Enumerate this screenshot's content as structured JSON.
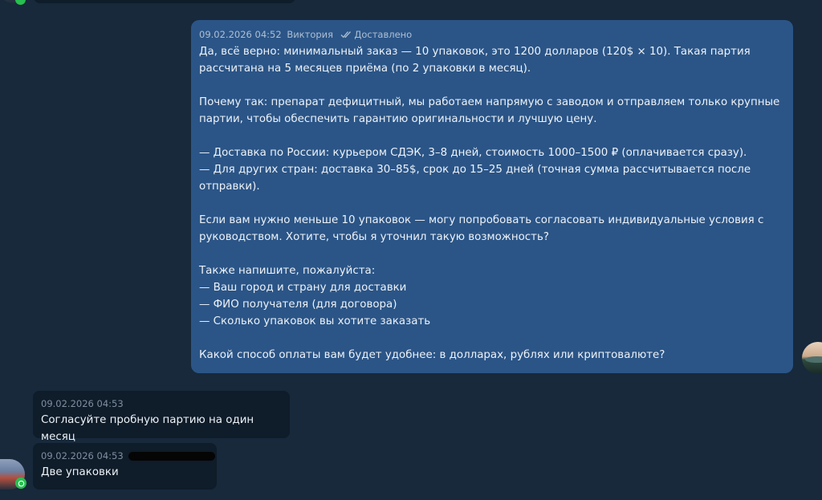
{
  "messages": [
    {
      "direction": "outgoing",
      "timestamp": "09.02.2026 04:52",
      "sender": "Виктория",
      "status": "Доставлено",
      "text": "Да, всё верно: минимальный заказ — 10 упаковок, это 1200 долларов (120$ × 10). Такая партия\nрассчитана на 5 месяцев приёма (по 2 упаковки в месяц).\n\nПочему так: препарат дефицитный, мы работаем напрямую с заводом и отправляем только крупные\nпартии, чтобы обеспечить гарантию оригинальности и лучшую цену.\n\n— Доставка по России: курьером СДЭК, 3–8 дней, стоимость 1000–1500 ₽ (оплачивается сразу).\n— Для других стран: доставка 30–85$, срок до 15–25 дней (точная сумма рассчитывается после\nотправки).\n\nЕсли вам нужно меньше 10 упаковок — могу попробовать согласовать индивидуальные условия с\nруководством. Хотите, чтобы я уточнил такую возможность?\n\nТакже напишите, пожалуйста:\n— Ваш город и страну для доставки\n— ФИО получателя (для договора)\n— Сколько упаковок вы хотите заказать\n\nКакой способ оплаты вам будет удобнее: в долларах, рублях или криптовалюте?"
    },
    {
      "direction": "incoming",
      "timestamp": "09.02.2026 04:53",
      "text": "Согласуйте пробную партию на один месяц"
    },
    {
      "direction": "incoming",
      "timestamp": "09.02.2026 04:53",
      "text": "Две упаковки"
    }
  ],
  "colors": {
    "background": "#17293b",
    "outgoing_bubble": "#2b5587",
    "incoming_bubble": "#0f1c29",
    "whatsapp_badge": "#27c04f"
  },
  "icons": {
    "status": "double-check-icon",
    "channel": "whatsapp-icon"
  }
}
